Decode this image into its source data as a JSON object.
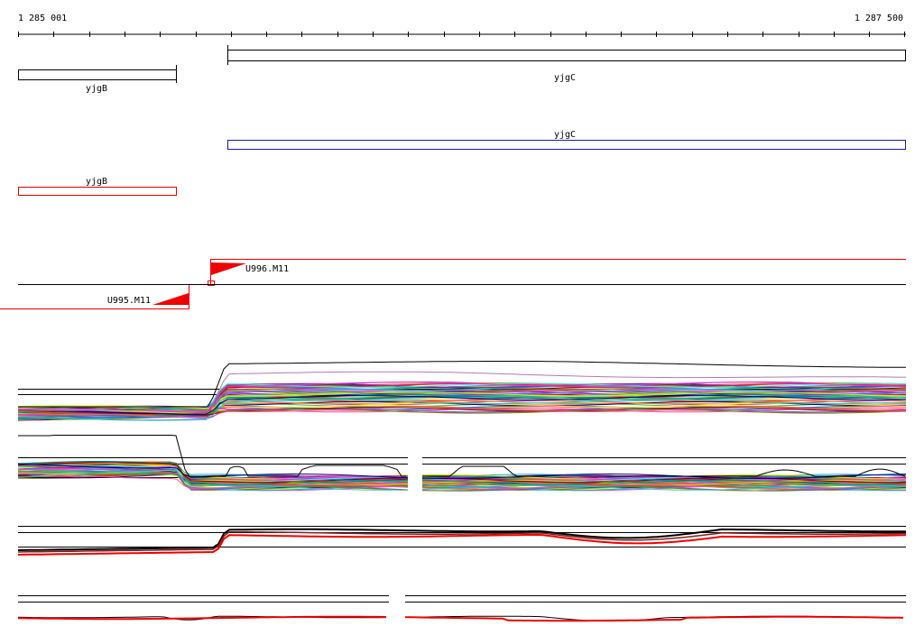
{
  "ruler": {
    "start_label": "1 285 001",
    "end_label": "1 287 500"
  },
  "genes": {
    "top_left": {
      "label": "yjgB"
    },
    "top_right": {
      "label": "yjgC"
    },
    "blue": {
      "label": "yjgC"
    },
    "red": {
      "label": "yjgB"
    }
  },
  "transcripts": {
    "forward": {
      "label": "U996.M11"
    },
    "reverse": {
      "label": "U995.M11"
    }
  },
  "colors": {
    "gene_outline": "#000000",
    "gene_blue": "#1a1aa8",
    "gene_red": "#dd0000",
    "transcript": "#ee0000",
    "axis": "#000000"
  }
}
